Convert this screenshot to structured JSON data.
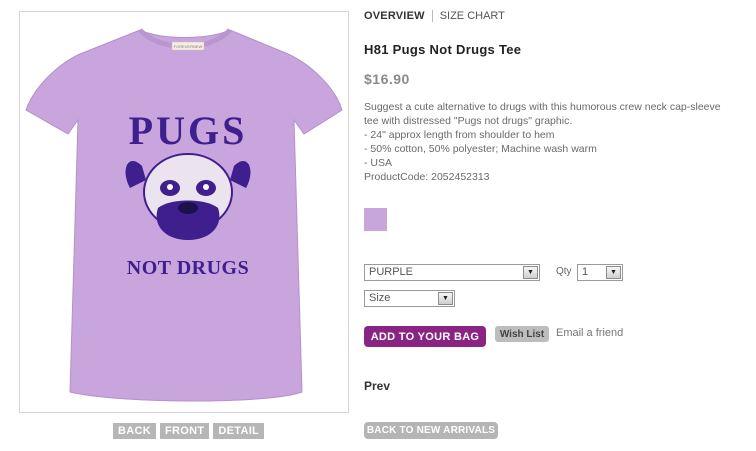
{
  "tabs": {
    "overview": "OVERVIEW",
    "size_chart": "SIZE CHART"
  },
  "product": {
    "title": "H81 Pugs Not Drugs Tee",
    "price": "$16.90",
    "description_lines": [
      "Suggest a cute alternative to drugs with this humorous crew neck cap-sleeve",
      "tee with distressed \"Pugs not drugs\" graphic.",
      "- 24\" approx length from shoulder to hem",
      "- 50% cotton, 50% polyester; Machine wash warm",
      "- USA",
      "ProductCode: 2052452313"
    ],
    "swatch_color": "#c9a5dd",
    "graphic_text_top": "PUGS",
    "graphic_text_bottom": "NOT DRUGS",
    "tag_text": "FOREVERNEW"
  },
  "options": {
    "color_value": "PURPLE",
    "size_value": "Size",
    "qty_label": "Qty",
    "qty_value": "1"
  },
  "actions": {
    "add_to_bag": "ADD TO YOUR BAG",
    "wish_list": "Wish List",
    "email_friend": "Email a friend",
    "prev": "Prev",
    "back_to_new_arrivals": "BACK TO NEW ARRIVALS"
  },
  "view_buttons": [
    "BACK",
    "FRONT",
    "DETAIL"
  ],
  "colors": {
    "shirt": "#c9a5dd",
    "print": "#3f1f8e",
    "add_bag_button": "#8a2484",
    "grey_button": "#b5b5b5"
  }
}
